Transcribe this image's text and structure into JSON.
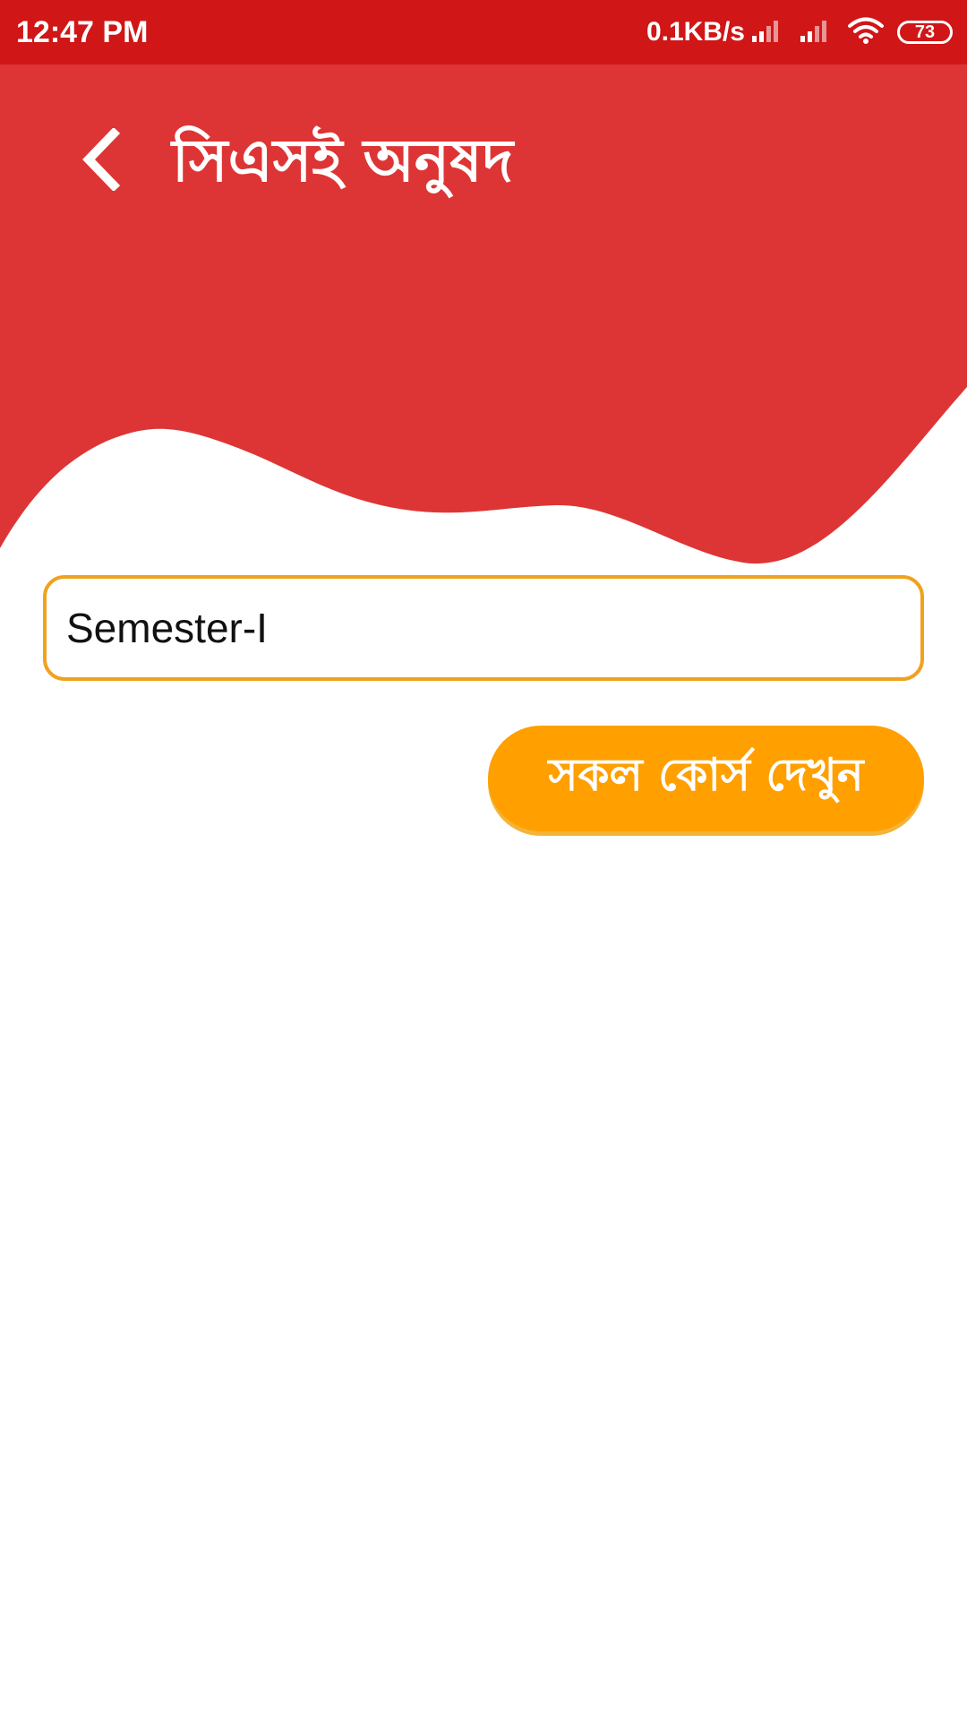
{
  "status_bar": {
    "time": "12:47 PM",
    "net_speed": "0.1KB/s",
    "battery": "73",
    "icons": [
      "signal-icon",
      "signal-icon",
      "wifi-icon",
      "battery-icon"
    ]
  },
  "header": {
    "title": "সিএসই অনুষদ",
    "back_icon": "chevron-left-icon"
  },
  "form": {
    "semester_value": "Semester-I"
  },
  "actions": {
    "view_courses_label": "সকল কোর্স দেখুন"
  },
  "colors": {
    "status_bar": "#d01616",
    "header": "#dd3535",
    "field_border": "#f0a21f",
    "button": "#ff9f00"
  }
}
